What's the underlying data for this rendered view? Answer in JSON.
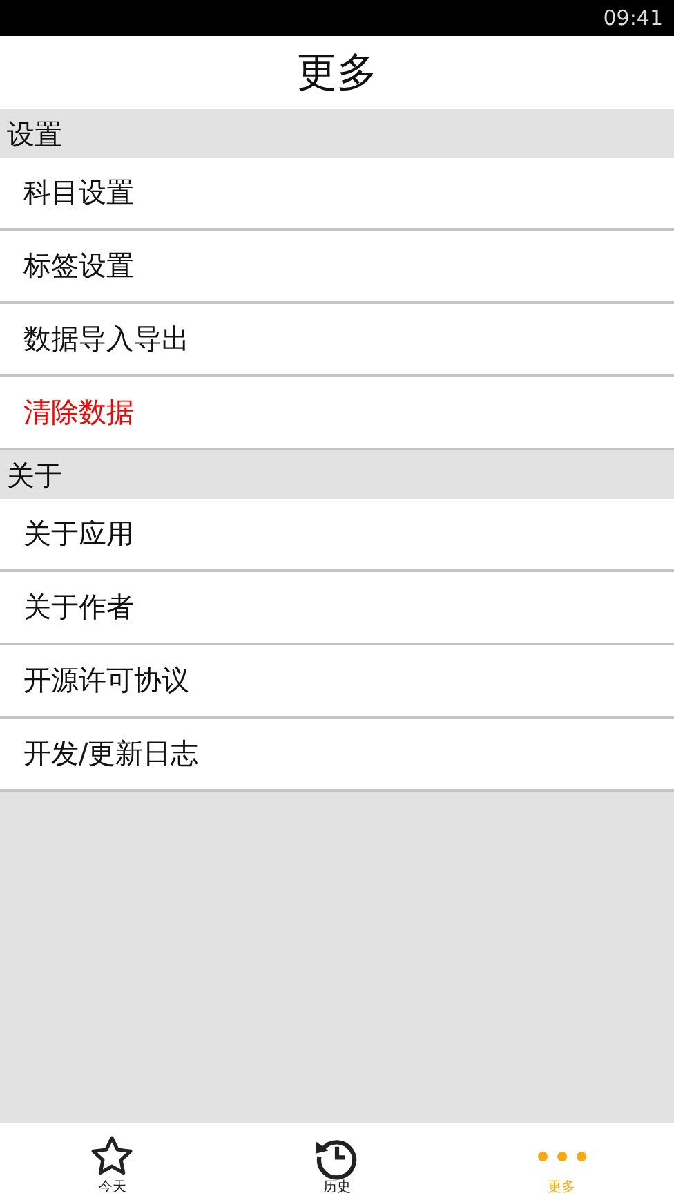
{
  "status_bar": {
    "time": "09:41"
  },
  "title": "更多",
  "sections": [
    {
      "header": "设置",
      "items": [
        {
          "label": "科目设置",
          "danger": false
        },
        {
          "label": "标签设置",
          "danger": false
        },
        {
          "label": "数据导入导出",
          "danger": false
        },
        {
          "label": "清除数据",
          "danger": true
        }
      ]
    },
    {
      "header": "关于",
      "items": [
        {
          "label": "关于应用",
          "danger": false
        },
        {
          "label": "关于作者",
          "danger": false
        },
        {
          "label": "开源许可协议",
          "danger": false
        },
        {
          "label": "开发/更新日志",
          "danger": false
        }
      ]
    }
  ],
  "tabs": [
    {
      "kind": "star",
      "label": "今天",
      "selected": false
    },
    {
      "kind": "history",
      "label": "历史",
      "selected": false
    },
    {
      "kind": "more",
      "label": "更多",
      "selected": true
    }
  ]
}
